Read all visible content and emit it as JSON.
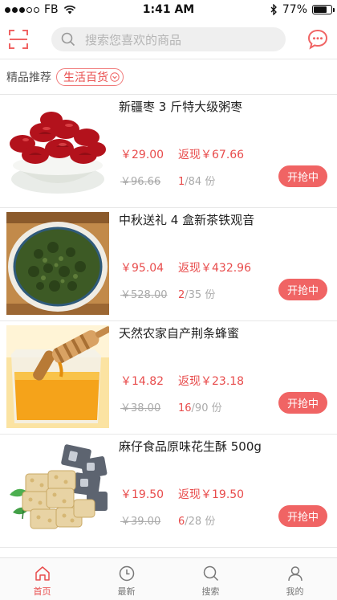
{
  "status_bar": {
    "carrier": "FB",
    "time": "1:41 AM",
    "battery": "77%",
    "battery_level": 0.77
  },
  "header": {
    "search_placeholder": "搜索您喜欢的商品",
    "icons": {
      "scan": "scan-icon",
      "search": "search-icon",
      "message": "chat-icon"
    },
    "accent": "#f06464"
  },
  "filter": {
    "title": "精品推荐",
    "selected": "生活百货"
  },
  "products": [
    {
      "title": "新疆枣 3 斤特大级粥枣",
      "price": "￥29.00",
      "rebate": "返现￥67.66",
      "original_price": "￥96.66",
      "sold": "1",
      "total": "/84 份",
      "button": "开抢中",
      "image": "red-dates-bowl"
    },
    {
      "title": "中秋送礼 4 盒新茶铁观音",
      "price": "￥95.04",
      "rebate": "返现￥432.96",
      "original_price": "￥528.00",
      "sold": "2",
      "total": "/35 份",
      "button": "开抢中",
      "image": "green-tea-leaves"
    },
    {
      "title": "天然农家自产荆条蜂蜜",
      "price": "￥14.82",
      "rebate": "返现￥23.18",
      "original_price": "￥38.00",
      "sold": "16",
      "total": "/90 份",
      "button": "开抢中",
      "image": "honey-jar-dipper"
    },
    {
      "title": "麻仔食品原味花生酥 500g",
      "price": "￥19.50",
      "rebate": "返现￥19.50",
      "original_price": "￥39.00",
      "sold": "6",
      "total": "/28 份",
      "button": "开抢中",
      "image": "peanut-brittle"
    }
  ],
  "tabbar": {
    "tabs": [
      {
        "label": "首页",
        "icon": "home-icon",
        "active": true
      },
      {
        "label": "最新",
        "icon": "clock-icon",
        "active": false
      },
      {
        "label": "搜索",
        "icon": "search-icon",
        "active": false
      },
      {
        "label": "我的",
        "icon": "user-icon",
        "active": false
      }
    ]
  }
}
